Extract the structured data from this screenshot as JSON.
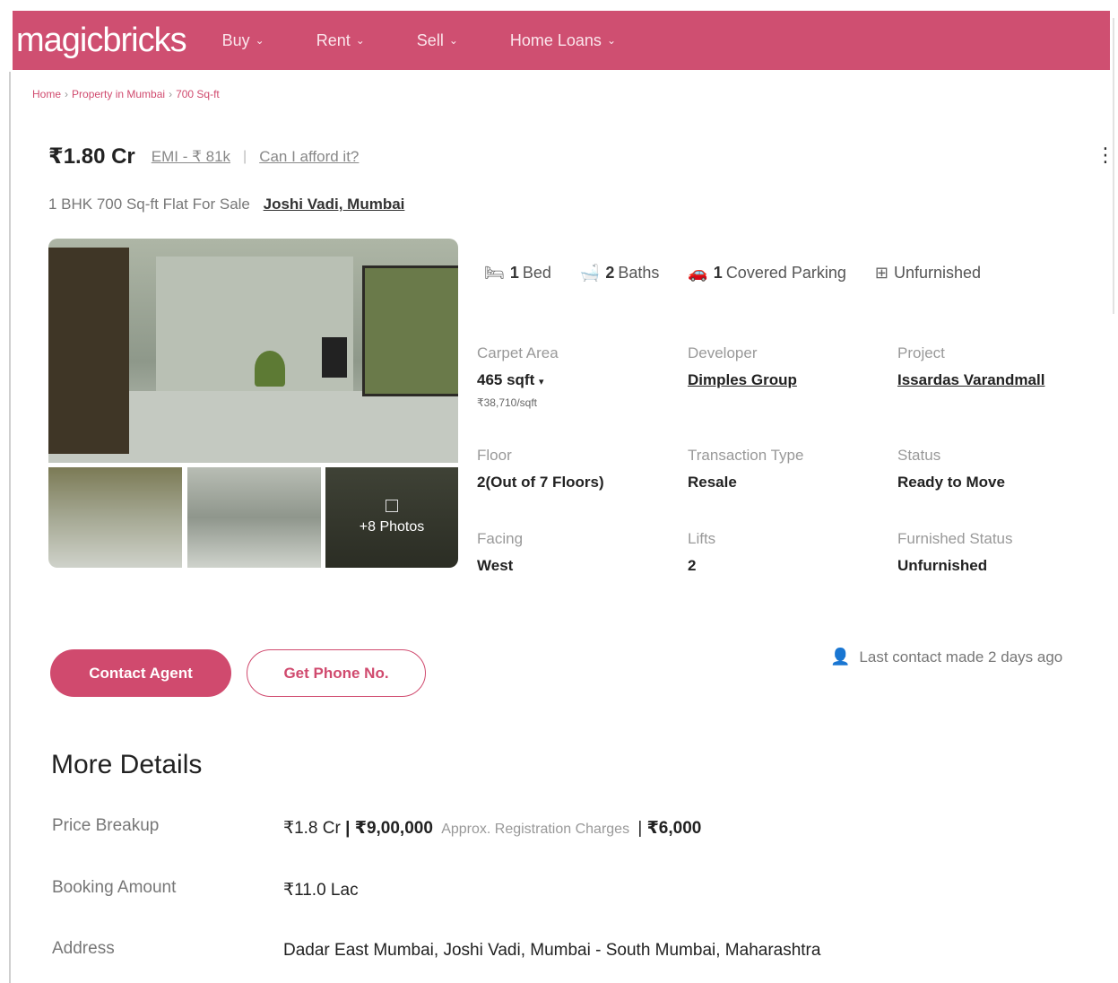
{
  "header": {
    "logo": "magicbricks",
    "nav": [
      {
        "label": "Buy"
      },
      {
        "label": "Rent"
      },
      {
        "label": "Sell"
      },
      {
        "label": "Home Loans"
      }
    ]
  },
  "breadcrumb": [
    "Home",
    "Property in Mumbai",
    "700 Sq-ft"
  ],
  "listing": {
    "price": "₹1.80 Cr",
    "emi": "EMI - ₹ 81k",
    "afford": "Can I afford it?",
    "title": "1 BHK 700 Sq-ft Flat For Sale",
    "locality": "Joshi Vadi, Mumbai",
    "more_photos": "+8 Photos"
  },
  "features": [
    {
      "icon": "bed-icon",
      "count": "1",
      "label": "Bed"
    },
    {
      "icon": "bath-icon",
      "count": "2",
      "label": "Baths"
    },
    {
      "icon": "car-icon",
      "count": "1",
      "label": "Covered Parking"
    },
    {
      "icon": "furnishing-icon",
      "count": "",
      "label": "Unfurnished"
    }
  ],
  "details": {
    "carpet_area": {
      "label": "Carpet Area",
      "value": "465 sqft",
      "sub": "₹38,710/sqft"
    },
    "developer": {
      "label": "Developer",
      "value": "Dimples Group"
    },
    "project": {
      "label": "Project",
      "value": "Issardas Varandmall"
    },
    "floor": {
      "label": "Floor",
      "value": "2(Out of 7 Floors)"
    },
    "transaction": {
      "label": "Transaction Type",
      "value": "Resale"
    },
    "status": {
      "label": "Status",
      "value": "Ready to Move"
    },
    "facing": {
      "label": "Facing",
      "value": "West"
    },
    "lifts": {
      "label": "Lifts",
      "value": "2"
    },
    "furnished": {
      "label": "Furnished Status",
      "value": "Unfurnished"
    }
  },
  "actions": {
    "contact_agent": "Contact Agent",
    "get_phone": "Get Phone No.",
    "last_contact": "Last contact made 2 days ago"
  },
  "more_details": {
    "title": "More Details",
    "price_breakup": {
      "label": "Price Breakup",
      "price": "₹1.8 Cr",
      "extra": "₹9,00,000",
      "approx": "Approx. Registration Charges",
      "charges": "₹6,000"
    },
    "booking": {
      "label": "Booking Amount",
      "value": "₹11.0 Lac"
    },
    "address": {
      "label": "Address",
      "value": "Dadar East Mumbai, Joshi Vadi, Mumbai - South Mumbai, Maharashtra"
    }
  }
}
